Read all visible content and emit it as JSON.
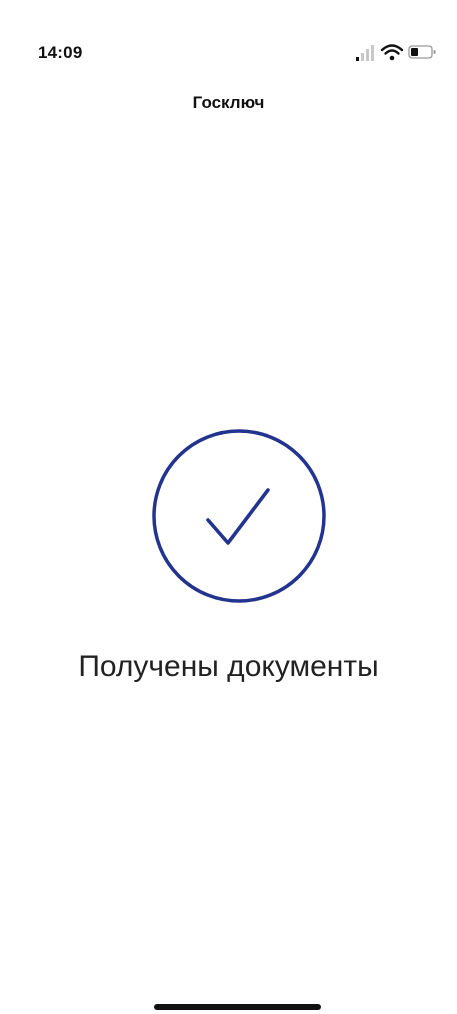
{
  "status_bar": {
    "time": "14:09",
    "icons": [
      "cellular-signal-icon",
      "wifi-icon",
      "battery-icon"
    ]
  },
  "header": {
    "title": "Госключ"
  },
  "main": {
    "status_icon": "checkmark-circle-icon",
    "message": "Получены документы"
  },
  "colors": {
    "accent": "#23348f",
    "text": "#222222",
    "background": "#ffffff"
  }
}
